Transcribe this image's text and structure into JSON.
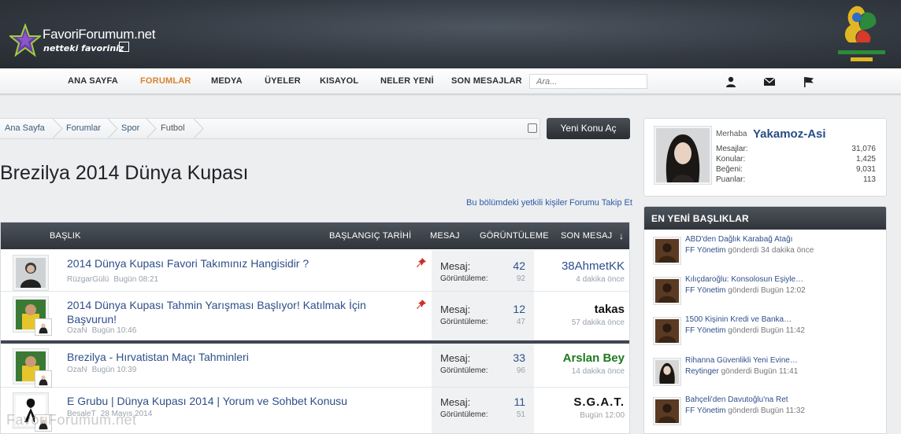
{
  "logo": {
    "title": "FavoriForumum.net",
    "subtitle": "netteki favoriniz"
  },
  "nav": {
    "items": [
      "ANA SAYFA",
      "FORUMLAR",
      "MEDYA",
      "ÜYELER",
      "KISAYOL",
      "NELER YENİ",
      "SON MESAJLAR"
    ],
    "active": "FORUMLAR",
    "search_placeholder": "Ara..."
  },
  "breadcrumb": [
    "Ana Sayfa",
    "Forumlar",
    "Spor",
    "Futbol"
  ],
  "new_thread_label": "Yeni Konu Aç",
  "page_title": "Brezilya 2014 Dünya Kupası",
  "util_links": [
    "Bu bölümdeki yetkili kişiler",
    "Forumu Takip Et"
  ],
  "columns": [
    "BAŞLIK",
    "BAŞLANGIÇ TARİHİ",
    "MESAJ",
    "GÖRÜNTÜLEME",
    "SON MESAJ"
  ],
  "stat_labels": {
    "replies": "Mesaj:",
    "views": "Görüntüleme:"
  },
  "threads": [
    {
      "title": "2014 Dünya Kupası Favori Takımınız Hangisidir ?",
      "author": "RüzgarGülü",
      "date": "Bugün 08:21",
      "replies": "42",
      "views": "92",
      "last_user": "38AhmetKK",
      "last_time": "4 dakika önce",
      "last_color": "#2f4f8a",
      "sticky": true
    },
    {
      "title": "2014 Dünya Kupası Tahmin Yarışması Başlıyor! Katılmak İçin Başvurun!",
      "author": "OzaN",
      "date": "Bugün 10:46",
      "replies": "12",
      "views": "47",
      "last_user": "takas",
      "last_time": "57 dakika önce",
      "last_color": "#111111",
      "sticky": true
    },
    {
      "title": "Brezilya - Hırvatistan Maçı Tahminleri",
      "author": "OzaN",
      "date": "Bugün 10:39",
      "replies": "33",
      "views": "96",
      "last_user": "Arslan Bey",
      "last_time": "14 dakika önce",
      "last_color": "#1e7a1e",
      "sticky": false
    },
    {
      "title": "E Grubu | Dünya Kupası 2014 | Yorum ve Sohbet Konusu",
      "author": "BesaleT",
      "date": "28 Mayıs 2014",
      "replies": "11",
      "views": "51",
      "last_user": "S.G.A.T.",
      "last_time": "Bugün 12:00",
      "last_color": "#111111",
      "sticky": false
    }
  ],
  "profile": {
    "greeting": "Merhaba",
    "username": "Yakamoz-Asi",
    "stats": [
      {
        "label": "Mesajlar:",
        "value": "31,076"
      },
      {
        "label": "Konular:",
        "value": "1,425"
      },
      {
        "label": "Beğeni:",
        "value": "9,031"
      },
      {
        "label": "Puanlar:",
        "value": "113"
      }
    ]
  },
  "latest": {
    "heading": "EN YENİ BAŞLIKLAR",
    "items": [
      {
        "title": "ABD'den Dağlık Karabağ Atağı",
        "user": "FF Yönetim",
        "rest": "gönderdi 34 dakika önce"
      },
      {
        "title": "Kılıçdaroğlu: Konsolosun Eşiyle…",
        "user": "FF Yönetim",
        "rest": "gönderdi Bugün 12:02"
      },
      {
        "title": "1500 Kişinin Kredi ve Banka…",
        "user": "FF Yönetim",
        "rest": "gönderdi Bugün 11:42"
      },
      {
        "title": "Rihanna Güvenlikli Yeni Evine…",
        "user": "Reytinger",
        "rest": "gönderdi Bugün 11:41"
      },
      {
        "title": "Bahçeli'den Davutoğlu'na Ret",
        "user": "FF Yönetim",
        "rest": "gönderdi Bugün 11:32"
      }
    ]
  },
  "watermark": "FavoriForumum.net",
  "colors": {
    "header_bg": "#343a42",
    "accent": "#d9822b",
    "link": "#2f4f8a",
    "table_head": "#3f4650"
  },
  "icons": [
    "user-icon",
    "envelope-icon",
    "flag-icon",
    "pin-icon",
    "external-link-icon",
    "sort-down-icon"
  ]
}
